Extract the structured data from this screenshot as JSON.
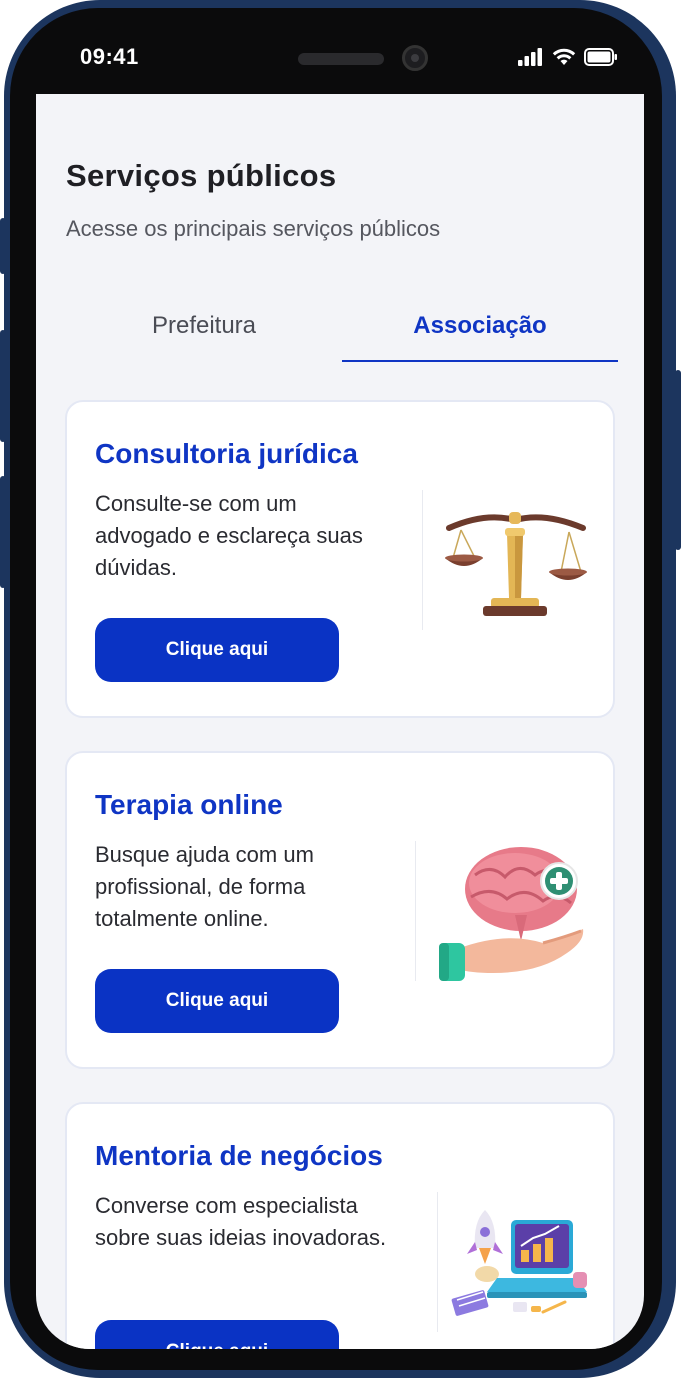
{
  "status_bar": {
    "time": "09:41"
  },
  "header": {
    "title": "Serviços públicos",
    "subtitle": "Acesse os principais serviços públicos"
  },
  "tabs": [
    {
      "label": "Prefeitura",
      "active": false
    },
    {
      "label": "Associação",
      "active": true
    }
  ],
  "cards": [
    {
      "title": "Consultoria jurídica",
      "description": "Consulte-se com um advogado e esclareça suas dúvidas.",
      "button_label": "Clique aqui",
      "illustration": "scales-of-justice-icon"
    },
    {
      "title": "Terapia online",
      "description": "Busque ajuda com um profissional, de forma totalmente online.",
      "button_label": "Clique aqui",
      "illustration": "brain-in-hand-icon"
    },
    {
      "title": "Mentoria de negócios",
      "description": "Converse com especialista sobre suas ideias inovadoras.",
      "button_label": "Clique aqui",
      "illustration": "business-laptop-rocket-icon"
    }
  ],
  "colors": {
    "accent": "#0a33c4",
    "title_blue": "#0f35c4",
    "screen_bg": "#f3f4f8",
    "frame": "#1c355e"
  }
}
